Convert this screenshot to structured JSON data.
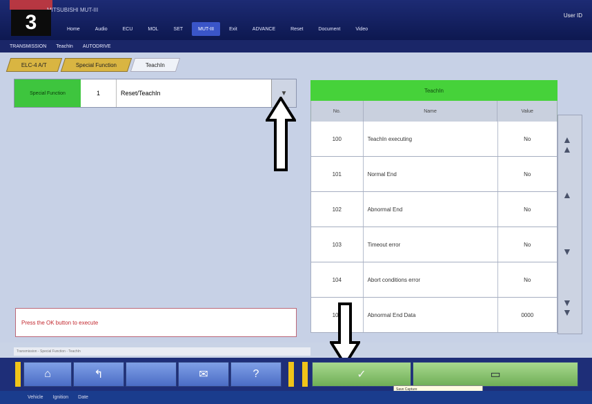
{
  "window": {
    "title": "MITSUBISHI MUT-III",
    "user": "User ID"
  },
  "nav": {
    "items": [
      "Home",
      "Audio",
      "ECU",
      "MOL",
      "SET",
      "MUT-III",
      "Exit",
      "ADVANCE",
      "Reset",
      "Document",
      "Video"
    ]
  },
  "breadcrumb": [
    "TRANSMISSION",
    "TeachIn",
    "AUTODRIVE"
  ],
  "tabs": [
    "ELC-4 A/T",
    "Special Function",
    "TeachIn"
  ],
  "function": {
    "label": "Special Function",
    "number": "1",
    "selected": "Reset/TeachIn"
  },
  "message": "Press the OK button to execute",
  "table": {
    "header": "TeachIn",
    "columns": [
      "No.",
      "Name",
      "Value"
    ],
    "rows": [
      {
        "no": "100",
        "name": "TeachIn executing",
        "value": "No"
      },
      {
        "no": "101",
        "name": "Normal End",
        "value": "No"
      },
      {
        "no": "102",
        "name": "Abnormal End",
        "value": "No"
      },
      {
        "no": "103",
        "name": "Timeout error",
        "value": "No"
      },
      {
        "no": "104",
        "name": "Abort conditions error",
        "value": "No"
      },
      {
        "no": "105",
        "name": "Abnormal End Data",
        "value": "0000"
      }
    ]
  },
  "statusline": "Transmission - Special Function - TeachIn",
  "toolbar": {
    "home": "⌂",
    "back": "↰",
    "print": "✉",
    "help": "?",
    "ok": "✓",
    "next": "▭"
  },
  "taskbar": [
    "Vehicle",
    "Ignition",
    "Date"
  ],
  "tooltip": "Save Capture"
}
